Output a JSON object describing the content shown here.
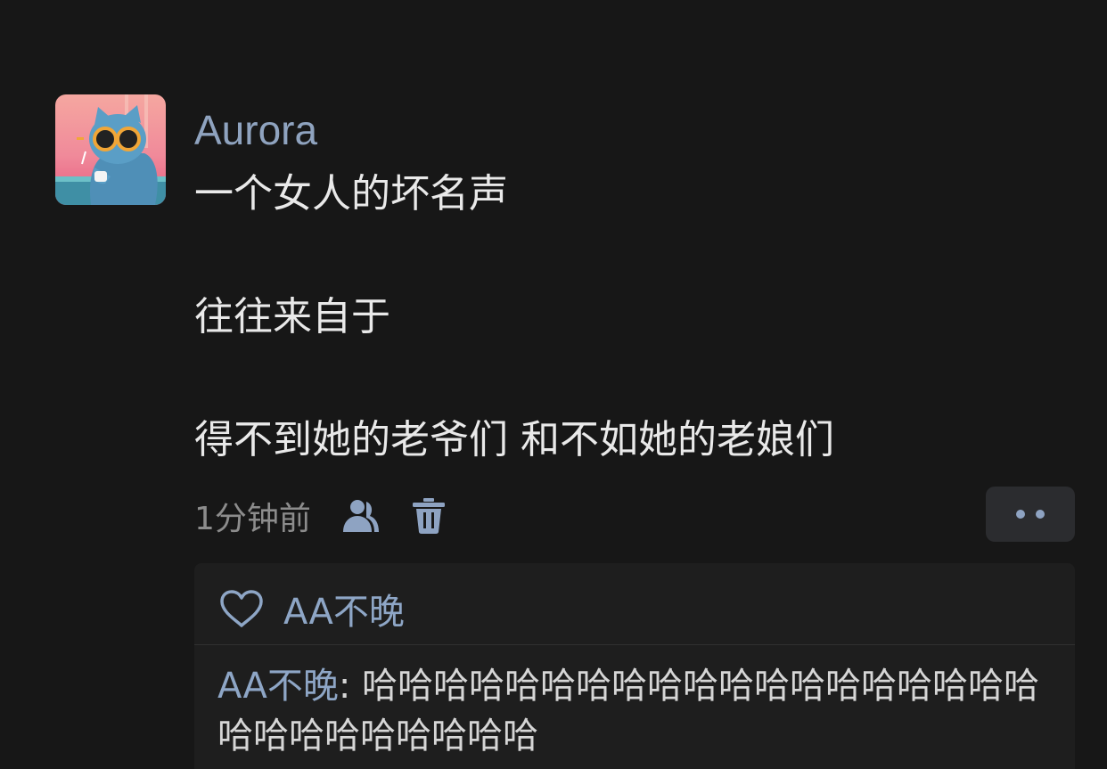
{
  "post": {
    "username": "Aurora",
    "lines": [
      "一个女人的坏名声",
      "往往来自于",
      "得不到她的老爷们 和不如她的老娘们"
    ],
    "timestamp": "1分钟前"
  },
  "icons": {
    "visibility": "person-icon",
    "delete": "trash-icon",
    "more": "more-dots-icon",
    "like": "heart-icon"
  },
  "likes": {
    "names": "AA不晚"
  },
  "comments": [
    {
      "author": "AA不晚",
      "separator": ": ",
      "text": "哈哈哈哈哈哈哈哈哈哈哈哈哈哈哈哈哈哈哈哈哈哈哈哈哈哈哈哈"
    }
  ],
  "colors": {
    "background": "#171717",
    "accent": "#8ea6c6",
    "text": "#e9e9e9",
    "muted": "#8c8c8c"
  }
}
